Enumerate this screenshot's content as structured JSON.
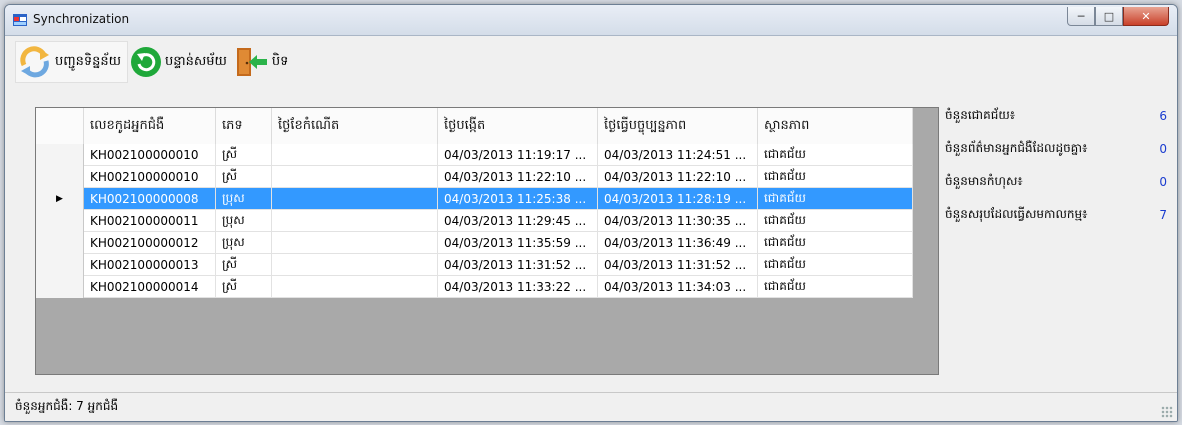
{
  "window": {
    "title": "Synchronization"
  },
  "toolbar": {
    "send_label": "បញ្ជូនទិន្នន័យ",
    "update_label": "បន្ទាន់សម័យ",
    "close_label": "បិទ"
  },
  "grid": {
    "columns": [
      "លេខកូដអ្នកជំងឺ",
      "ភេទ",
      "ថ្ងៃខែកំណើត",
      "ថ្ងៃបង្កើត",
      "ថ្ងៃធ្វើបច្ចុប្បន្នភាព",
      "ស្ថានភាព"
    ],
    "rows": [
      {
        "code": "KH002100000010",
        "sex": "ស្រី",
        "dob": "",
        "created": "04/03/2013 11:19:17 ...",
        "updated": "04/03/2013 11:24:51 ...",
        "status": "ជោគជ័យ"
      },
      {
        "code": "KH002100000010",
        "sex": "ស្រី",
        "dob": "",
        "created": "04/03/2013 11:22:10 ...",
        "updated": "04/03/2013 11:22:10 ...",
        "status": "ជោគជ័យ"
      },
      {
        "code": "KH002100000008",
        "sex": "ប្រុស",
        "dob": "",
        "created": "04/03/2013 11:25:38 ...",
        "updated": "04/03/2013 11:28:19 ...",
        "status": "ជោគជ័យ"
      },
      {
        "code": "KH002100000011",
        "sex": "ប្រុស",
        "dob": "",
        "created": "04/03/2013 11:29:45 ...",
        "updated": "04/03/2013 11:30:35 ...",
        "status": "ជោគជ័យ"
      },
      {
        "code": "KH002100000012",
        "sex": "ប្រុស",
        "dob": "",
        "created": "04/03/2013 11:35:59 ...",
        "updated": "04/03/2013 11:36:49 ...",
        "status": "ជោគជ័យ"
      },
      {
        "code": "KH002100000013",
        "sex": "ស្រី",
        "dob": "",
        "created": "04/03/2013 11:31:52 ...",
        "updated": "04/03/2013 11:31:52 ...",
        "status": "ជោគជ័យ"
      },
      {
        "code": "KH002100000014",
        "sex": "ស្រី",
        "dob": "",
        "created": "04/03/2013 11:33:22 ...",
        "updated": "04/03/2013 11:34:03 ...",
        "status": "ជោគជ័យ"
      }
    ],
    "selected_row": 2
  },
  "stats": [
    {
      "label": "ចំនួនជោគជ័យ៖",
      "value": "6"
    },
    {
      "label": "ចំនួនព័ត៌មានអ្នកជំងឺដែលដូចគ្នា៖",
      "value": "0"
    },
    {
      "label": "ចំនួនមានកំហុស៖",
      "value": "0"
    },
    {
      "label": "ចំនួនសរុបដែលធ្វើសមកាលកម្ម៖",
      "value": "7"
    }
  ],
  "status": {
    "text": "ចំនួនអ្នកជំងឺ:  7 អ្នកជំងឺ"
  },
  "colors": {
    "selection": "#3399ff",
    "stat_value": "#1a3ccf",
    "close_button": "#c9412a"
  }
}
